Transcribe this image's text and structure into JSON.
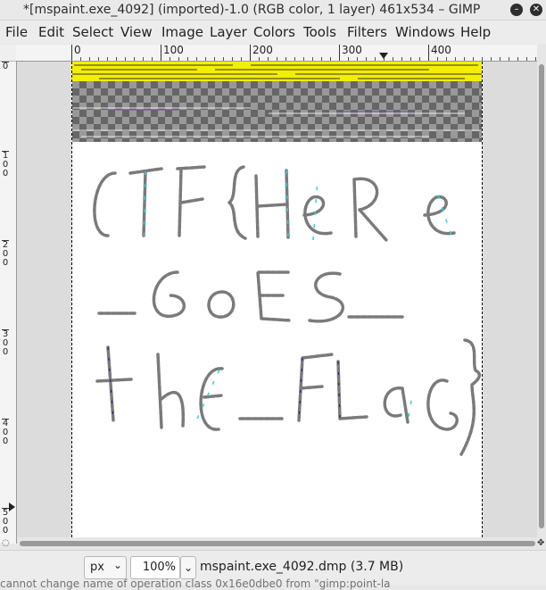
{
  "window": {
    "title": "*[mspaint.exe_4092] (imported)-1.0 (RGB color, 1 layer) 461x534 – GIMP",
    "minimize_icon": "minimize-icon",
    "close_icon": "close-icon"
  },
  "menu": {
    "items": [
      "File",
      "Edit",
      "Select",
      "View",
      "Image",
      "Layer",
      "Colors",
      "Tools",
      "Filters",
      "Windows",
      "Help"
    ]
  },
  "rulers": {
    "horizontal": [
      "0",
      "100",
      "200",
      "300",
      "400"
    ],
    "vertical": [
      "0",
      "100",
      "200",
      "300",
      "400",
      "500"
    ]
  },
  "canvas": {
    "colors": {
      "yellow_band": "#f4ee00",
      "ink": "#7a7a7a",
      "ink_highlight": "#2ad4d4",
      "ink_blue": "#1a2a8a"
    },
    "text_lines": [
      "CTF{HeRe",
      "_GoES_",
      "thE_FLaG}"
    ]
  },
  "status": {
    "unit": "px",
    "zoom": "100%",
    "file_info": "mspaint.exe_4092.dmp (3.7 MB)",
    "message": "cannot change name of operation class 0x16e0dbe0 from \"gimp:point-la"
  }
}
